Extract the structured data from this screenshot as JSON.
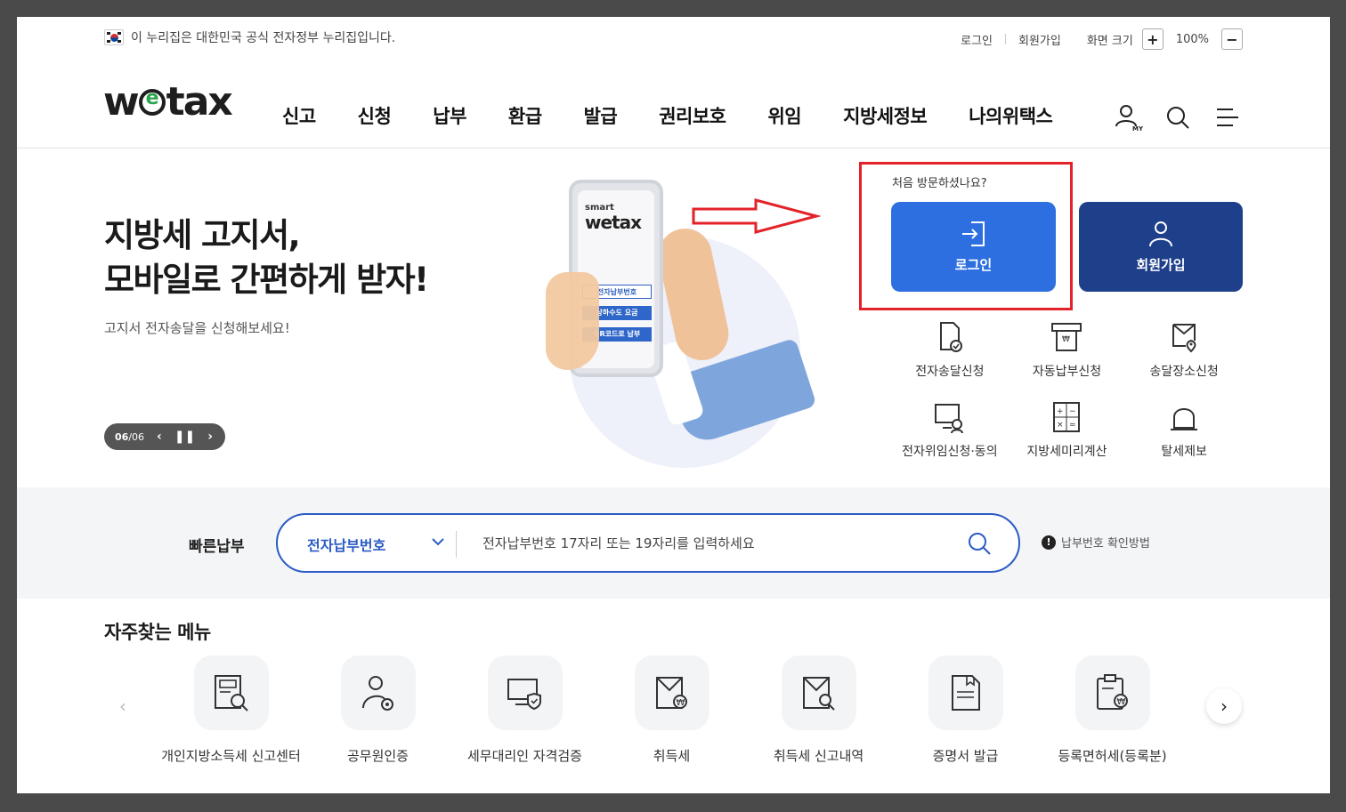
{
  "topbar": {
    "gov_notice": "이 누리집은 대한민국 공식 전자정부 누리집입니다.",
    "login": "로그인",
    "join": "회원가입",
    "screen_size": "화면 크기",
    "zoom_in": "+",
    "zoom_value": "100%",
    "zoom_out": "−"
  },
  "header": {
    "logo_w": "w",
    "logo_tax": "tax",
    "nav": [
      "신고",
      "신청",
      "납부",
      "환급",
      "발급",
      "권리보호",
      "위임",
      "지방세정보",
      "나의위택스"
    ],
    "my_label": "MY"
  },
  "hero": {
    "title_line1": "지방세 고지서,",
    "title_line2": "모바일로 간편하게 받자!",
    "subtitle": "고지서 전자송달을 신청해보세요!",
    "slide_current": "06",
    "slide_sep": " / ",
    "slide_total": "06",
    "phone_smart": "smart",
    "phone_logo": "wetax",
    "phone_btn1": "전자납부번호",
    "phone_btn2": "상하수도 요금",
    "phone_btn3": "QR코드로 납부"
  },
  "login_panel": {
    "first_visit": "처음 방문하셨나요?",
    "login_label": "로그인",
    "join_label": "회원가입",
    "login_color": "#2d6fe0",
    "join_color": "#1e3f8a"
  },
  "quick_links": [
    {
      "label": "전자송달신청",
      "icon": "document-check-icon"
    },
    {
      "label": "자동납부신청",
      "icon": "auto-pay-icon"
    },
    {
      "label": "송달장소신청",
      "icon": "location-doc-icon"
    },
    {
      "label": "전자위임신청·동의",
      "icon": "monitor-user-icon"
    },
    {
      "label": "지방세미리계산",
      "icon": "calculator-icon"
    },
    {
      "label": "탈세제보",
      "icon": "siren-icon"
    }
  ],
  "quick_pay": {
    "label": "빠른납부",
    "select_value": "전자납부번호",
    "input_placeholder": "전자납부번호 17자리 또는 19자리를 입력하세요",
    "help_icon": "!",
    "help_text": "납부번호 확인방법"
  },
  "frequent": {
    "title": "자주찾는 메뉴",
    "prev": "‹",
    "next": "›",
    "items": [
      {
        "label": "개인지방소득세 신고센터",
        "icon": "form-search-icon"
      },
      {
        "label": "공무원인증",
        "icon": "official-gear-icon"
      },
      {
        "label": "세무대리인 자격검증",
        "icon": "monitor-shield-icon"
      },
      {
        "label": "취득세",
        "icon": "envelope-won-icon"
      },
      {
        "label": "취득세 신고내역",
        "icon": "envelope-search-icon"
      },
      {
        "label": "증명서 발급",
        "icon": "certificate-icon"
      },
      {
        "label": "등록면허세(등록분)",
        "icon": "clipboard-won-icon"
      }
    ]
  }
}
